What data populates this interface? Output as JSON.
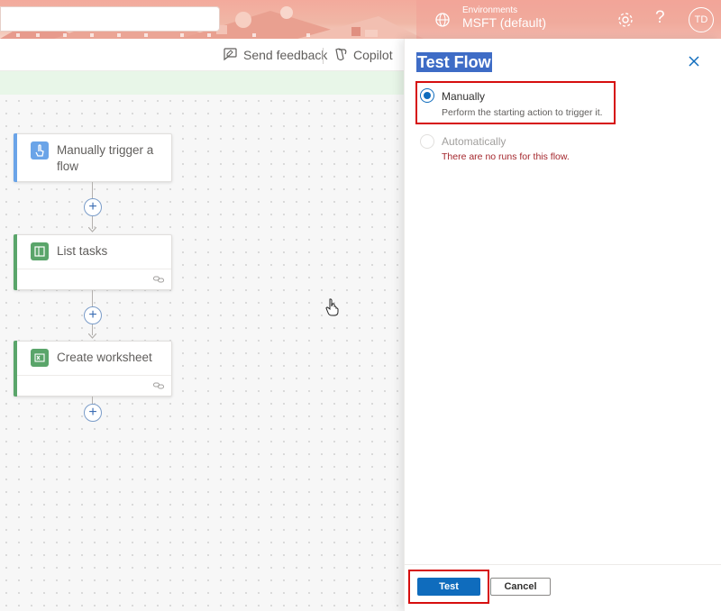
{
  "header": {
    "environment_label": "Environments",
    "environment_name": "MSFT (default)",
    "avatar_initials": "TD"
  },
  "command_bar": {
    "send_feedback": "Send feedback",
    "copilot": "Copilot"
  },
  "flow": {
    "cards": [
      {
        "title": "Manually trigger a flow",
        "icon": "touch-trigger-icon",
        "accent": "#6aa4e8"
      },
      {
        "title": "List tasks",
        "icon": "planner-icon",
        "accent": "#5aa56a"
      },
      {
        "title": "Create worksheet",
        "icon": "excel-icon",
        "accent": "#5aa56a"
      }
    ]
  },
  "test_panel": {
    "title": "Test Flow",
    "manual_label": "Manually",
    "manual_desc": "Perform the starting action to trigger it.",
    "auto_label": "Automatically",
    "auto_desc": "There are no runs for this flow.",
    "test_button": "Test",
    "cancel_button": "Cancel"
  },
  "colors": {
    "primary": "#0f6cbd",
    "highlight": "#d60e0e",
    "error_text": "#a4262c"
  }
}
